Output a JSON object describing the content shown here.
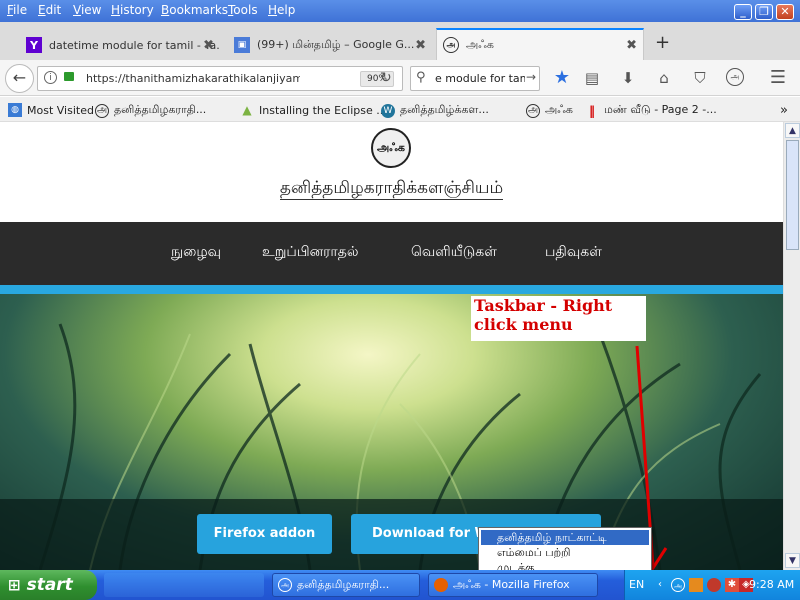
{
  "menubar": {
    "items": [
      "File",
      "Edit",
      "View",
      "History",
      "Bookmarks",
      "Tools",
      "Help"
    ]
  },
  "window_controls": {
    "minimize": "_",
    "restore": "❐",
    "close": "✕"
  },
  "tabs": [
    {
      "label": "datetime module for tamil - Ya...",
      "icon": "Y",
      "close": "✖"
    },
    {
      "label": "(99+) மின்தமிழ் – Google G...",
      "icon": "▣",
      "close": "✖"
    },
    {
      "label": "அஃக",
      "icon": "அ",
      "close": "✖"
    }
  ],
  "new_tab": "+",
  "toolbar": {
    "url": "https://thanithamizhakarathikalanjiyam.githu",
    "zoom": "90%",
    "search": "e module for tamil"
  },
  "bookmarks": [
    {
      "label": "Most Visited",
      "icon": "globe-icon"
    },
    {
      "label": "தனித்தமிழகராதி...",
      "icon": "site-icon"
    },
    {
      "label": "Installing the Eclipse ...",
      "icon": "android-icon"
    },
    {
      "label": "தனித்தமிழ்க்கள...",
      "icon": "wordpress-icon"
    },
    {
      "label": "அஃக",
      "icon": "site-icon"
    },
    {
      "label": "மண் வீடு - Page 2 -...",
      "icon": "bars-icon"
    }
  ],
  "page": {
    "logo_text": "அஃக",
    "site_title": "தனித்தமிழகராதிக்களஞ்சியம்",
    "nav": [
      "நுழைவு",
      "உறுப்பினராதல்",
      "வெளியீடுகள்",
      "பதிவுகள்"
    ],
    "hero_buttons": [
      "Firefox addon",
      "Download for W"
    ]
  },
  "annotation": "Taskbar - Right click menu",
  "context_menu": [
    "தனித்தமிழ் நாட்காட்டி",
    "எம்மைப் பற்றி",
    "முடக்கு"
  ],
  "taskbar": {
    "start": "start",
    "tasks": [
      "தனித்தமிழகராதி...",
      "அஃக - Mozilla Firefox"
    ],
    "lang": "EN",
    "clock": "9:28 AM"
  },
  "colors": {
    "accent": "#29a8e0",
    "nav_bg": "#2b2b2b",
    "button": "#27a3dd",
    "annotation": "#d40000",
    "menu_highlight": "#316ac5"
  }
}
